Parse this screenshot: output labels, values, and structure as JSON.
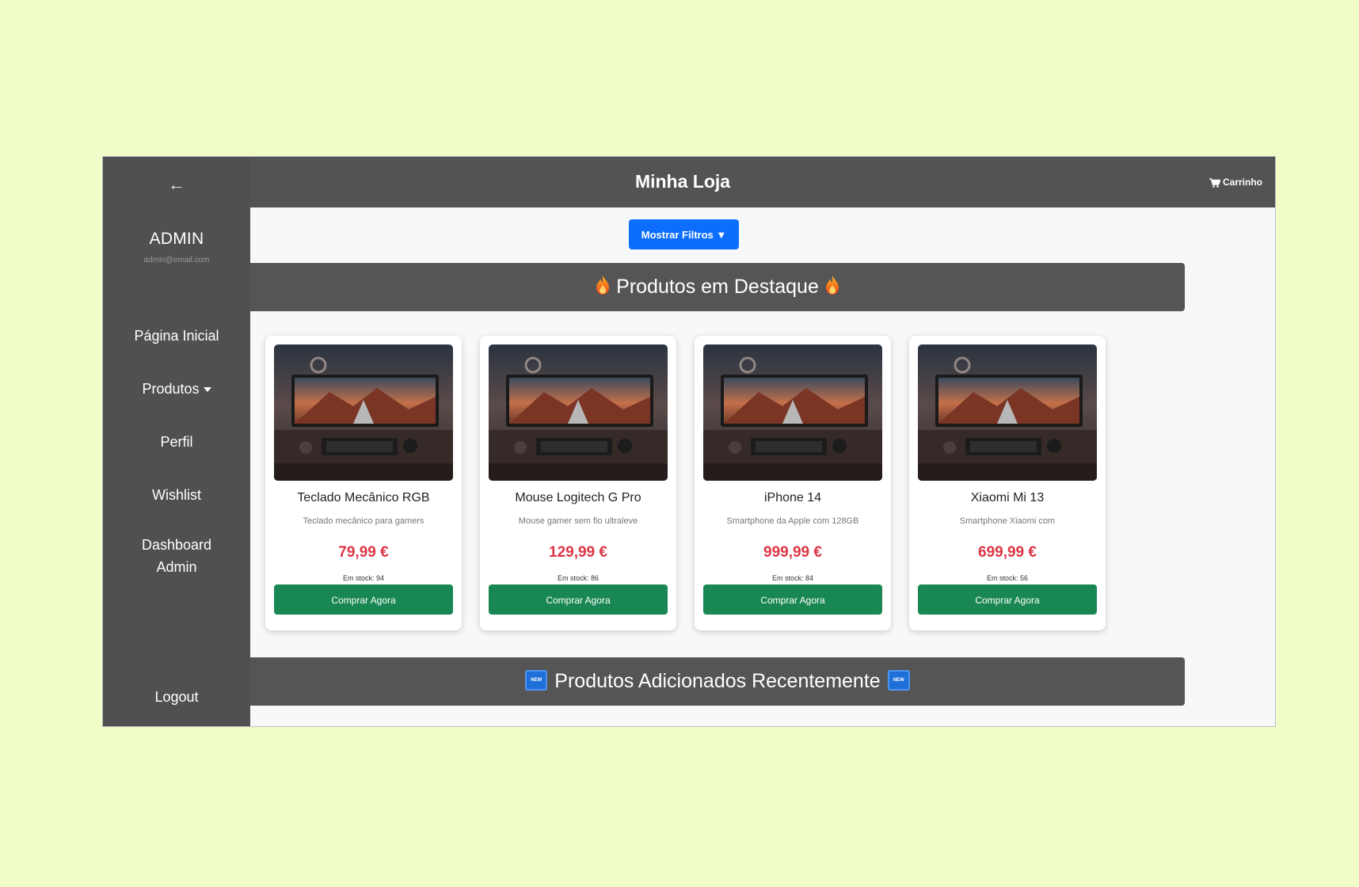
{
  "colors": {
    "page_background": "#f0fdc8",
    "sidebar": "#505050",
    "topbar": "#535353",
    "primary_button": "#0d6efd",
    "buy_button": "#198754",
    "price": "#dc3545"
  },
  "sidebar": {
    "back_icon": "left-arrow-icon",
    "back_glyph": "←",
    "user_name": "ADMIN",
    "user_email": "admin@email.com",
    "items": [
      {
        "label": "Página Inicial"
      },
      {
        "label": "Produtos"
      },
      {
        "label": "Perfil"
      },
      {
        "label": "Wishlist"
      },
      {
        "label": "Dashboard Admin"
      }
    ],
    "logout_label": "Logout"
  },
  "header": {
    "title": "Minha Loja",
    "cart_label": "Carrinho",
    "cart_icon": "shopping-cart-icon"
  },
  "filters": {
    "toggle_label": "Mostrar Filtros ▼"
  },
  "featured": {
    "title": "Produtos em Destaque",
    "icon": "fire-icon"
  },
  "recent": {
    "title": "Produtos Adicionados Recentemente",
    "icon": "new-badge-icon",
    "badge_text": "NEW"
  },
  "products": [
    {
      "name": "Teclado Mecânico RGB",
      "description": "Teclado mecânico para gamers",
      "price": "79,99 €",
      "stock": "Em stock: 94",
      "button": "Comprar Agora"
    },
    {
      "name": "Mouse Logitech G Pro",
      "description": "Mouse gamer sem fio ultraleve",
      "price": "129,99 €",
      "stock": "Em stock: 86",
      "button": "Comprar Agora"
    },
    {
      "name": "iPhone 14",
      "description": "Smartphone da Apple com 128GB",
      "price": "999,99 €",
      "stock": "Em stock: 84",
      "button": "Comprar Agora"
    },
    {
      "name": "Xiaomi Mi 13",
      "description": "Smartphone Xiaomi com",
      "price": "699,99 €",
      "stock": "Em stock: 56",
      "button": "Comprar Agora"
    }
  ]
}
